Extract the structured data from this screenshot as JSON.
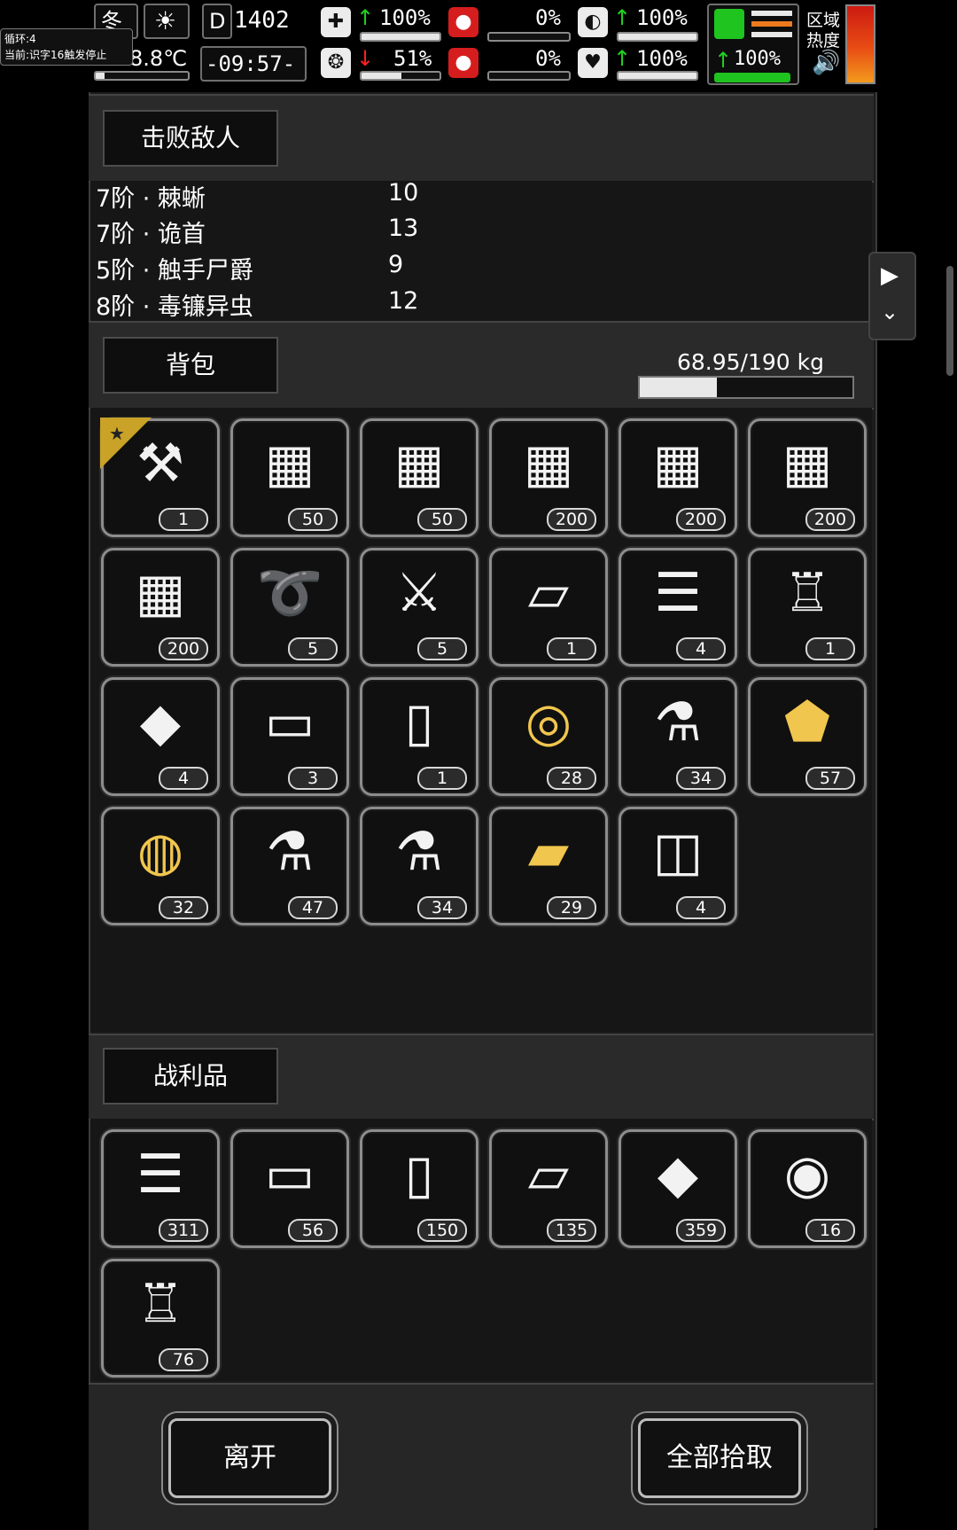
{
  "hud": {
    "season": "冬",
    "weather_icon": "sun-icon",
    "temperature": "8.8℃",
    "day": "1402",
    "time": "-09:57-",
    "tooltip_line1": "循环:4",
    "tooltip_line2": "当前:识字16触发停止",
    "stats": {
      "health": "100%",
      "hunger": "0%",
      "stamina": "100%",
      "sanity": "51%",
      "thirst": "0%",
      "mood": "100%",
      "speed": "100%"
    },
    "zone_heat_label": "区域热度"
  },
  "defeated": {
    "title": "击败敌人",
    "rows": [
      {
        "name": "7阶 · 棘蜥",
        "count": "10"
      },
      {
        "name": "7阶 · 诡首",
        "count": "13"
      },
      {
        "name": "5阶 · 触手尸爵",
        "count": "9"
      },
      {
        "name": "8阶 · 毒镰异虫",
        "count": "12"
      }
    ]
  },
  "backpack": {
    "title": "背包",
    "weight": "68.95/190 kg",
    "weight_fraction": 0.363,
    "items": [
      {
        "icon": "tools-icon",
        "count": "1",
        "starred": true
      },
      {
        "icon": "crate-v-icon",
        "count": "50"
      },
      {
        "icon": "crate-s-icon",
        "count": "50"
      },
      {
        "icon": "crate-iii-icon",
        "count": "200"
      },
      {
        "icon": "crate-iv-icon",
        "count": "200"
      },
      {
        "icon": "crate-ii-icon",
        "count": "200"
      },
      {
        "icon": "crate-i-icon",
        "count": "200"
      },
      {
        "icon": "rope-icon",
        "count": "5"
      },
      {
        "icon": "katana-icon",
        "count": "5"
      },
      {
        "icon": "cloth-icon",
        "count": "1"
      },
      {
        "icon": "folded-cloth-icon",
        "count": "4"
      },
      {
        "icon": "torn-shirt-icon",
        "count": "1"
      },
      {
        "icon": "ore-icon",
        "count": "4"
      },
      {
        "icon": "fabric-icon",
        "count": "3"
      },
      {
        "icon": "paper-icon",
        "count": "1"
      },
      {
        "icon": "gold-cable-icon",
        "count": "28"
      },
      {
        "icon": "vial-vi-icon",
        "count": "34"
      },
      {
        "icon": "gold-crystal-icon",
        "count": "57"
      },
      {
        "icon": "gold-thread-spool-icon",
        "count": "32"
      },
      {
        "icon": "vial-v-icon",
        "count": "47"
      },
      {
        "icon": "vial-vii-icon",
        "count": "34"
      },
      {
        "icon": "gold-cloth-icon",
        "count": "29"
      },
      {
        "icon": "bandage-roll-icon",
        "count": "4"
      }
    ]
  },
  "loot": {
    "title": "战利品",
    "items": [
      {
        "icon": "folded-cloth-icon",
        "count": "311"
      },
      {
        "icon": "fabric-icon",
        "count": "56"
      },
      {
        "icon": "paper-icon",
        "count": "150"
      },
      {
        "icon": "cloth-icon",
        "count": "135"
      },
      {
        "icon": "ore-icon",
        "count": "359"
      },
      {
        "icon": "scroll-roll-icon",
        "count": "16"
      },
      {
        "icon": "torn-shirt-icon",
        "count": "76"
      }
    ]
  },
  "actions": {
    "leave": "离开",
    "pick_all": "全部拾取"
  }
}
